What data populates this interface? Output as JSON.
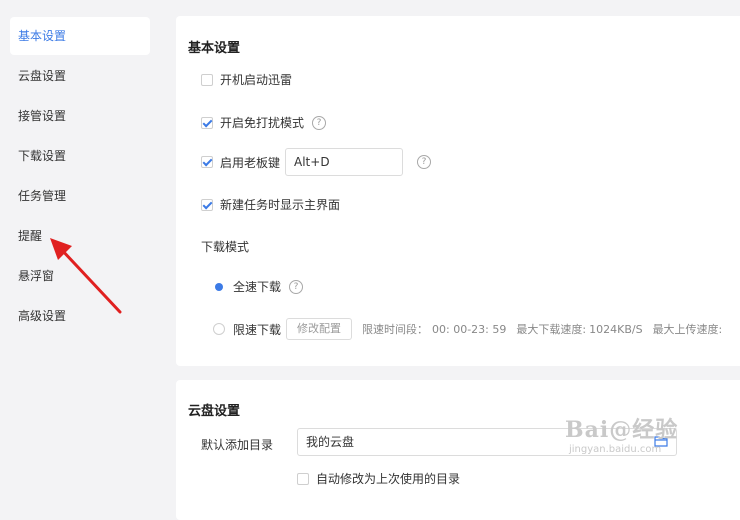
{
  "sidebar": {
    "items": [
      {
        "label": "基本设置",
        "active": true
      },
      {
        "label": "云盘设置"
      },
      {
        "label": "接管设置"
      },
      {
        "label": "下载设置"
      },
      {
        "label": "任务管理"
      },
      {
        "label": "提醒"
      },
      {
        "label": "悬浮窗"
      },
      {
        "label": "高级设置"
      }
    ]
  },
  "basic": {
    "title": "基本设置",
    "autostart": {
      "label": "开机启动迅雷",
      "checked": false
    },
    "dnd": {
      "label": "开启免打扰模式",
      "checked": true
    },
    "boss_key": {
      "label": "启用老板键",
      "checked": true,
      "value": "Alt+D"
    },
    "show_main": {
      "label": "新建任务时显示主界面",
      "checked": true
    },
    "download_mode": {
      "label": "下载模式",
      "full_speed": {
        "label": "全速下载",
        "selected": true
      },
      "limited": {
        "label": "限速下载",
        "selected": false,
        "button": "修改配置",
        "period_label": "限速时间段：",
        "period_value": "00: 00-23: 59",
        "max_down_label": "最大下载速度:",
        "max_down_value": "1024KB/S",
        "max_up_label": "最大上传速度:"
      }
    }
  },
  "cloud": {
    "title": "云盘设置",
    "default_dir_label": "默认添加目录",
    "default_dir_value": "我的云盘",
    "auto_change": {
      "label": "自动修改为上次使用的目录",
      "checked": false
    }
  },
  "help_glyph": "?",
  "annotation": {
    "color": "#e02020"
  },
  "watermark": {
    "main": "Bai@经验",
    "sub": "jingyan.baidu.com"
  },
  "colors": {
    "accent": "#3c7be6",
    "background": "#f3f3f5",
    "panel": "#ffffff"
  }
}
